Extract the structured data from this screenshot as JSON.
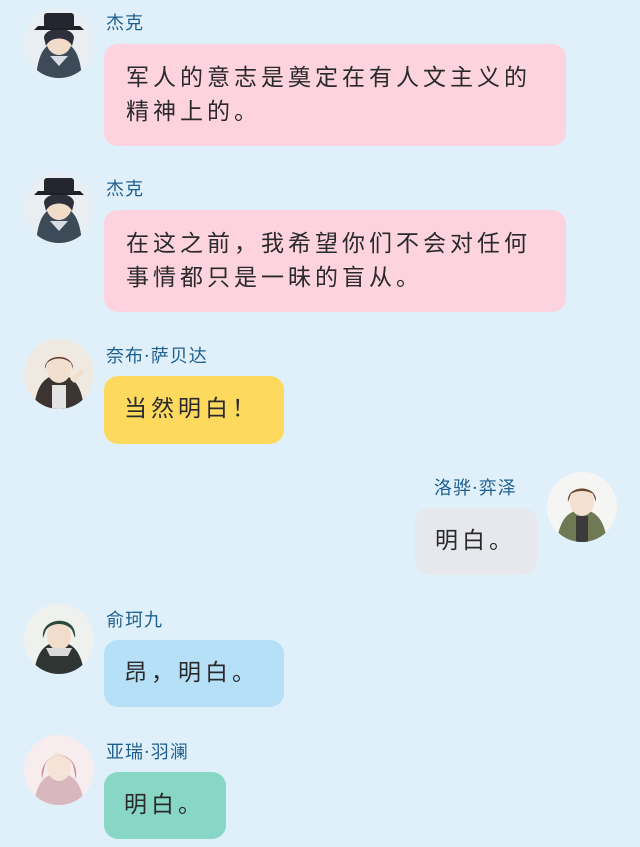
{
  "messages": [
    {
      "sender": "杰克",
      "text": "军人的意志是奠定在有人文主义的精神上的。",
      "side": "left",
      "color": "#fdd3df",
      "avatar": "dark-hat-avatar"
    },
    {
      "sender": "杰克",
      "text": "在这之前，我希望你们不会对任何事情都只是一昧的盲从。",
      "side": "left",
      "color": "#fdd3df",
      "avatar": "dark-hat-avatar"
    },
    {
      "sender": "奈布·萨贝达",
      "text": "当然明白！",
      "side": "left",
      "color": "#fdd95e",
      "avatar": "brown-hair-avatar"
    },
    {
      "sender": "洛骅·弈泽",
      "text": "明白。",
      "side": "right",
      "color": "#e6e8ee",
      "avatar": "green-jacket-avatar"
    },
    {
      "sender": "俞珂九",
      "text": "昂，明白。",
      "side": "left",
      "color": "#b5e0f8",
      "avatar": "green-hair-avatar"
    },
    {
      "sender": "亚瑞·羽澜",
      "text": "明白。",
      "side": "left",
      "color": "#88d6c6",
      "avatar": "pink-hair-avatar"
    }
  ],
  "colors": {
    "background": "#dff0fb",
    "name_text": "#1f5f8f"
  }
}
